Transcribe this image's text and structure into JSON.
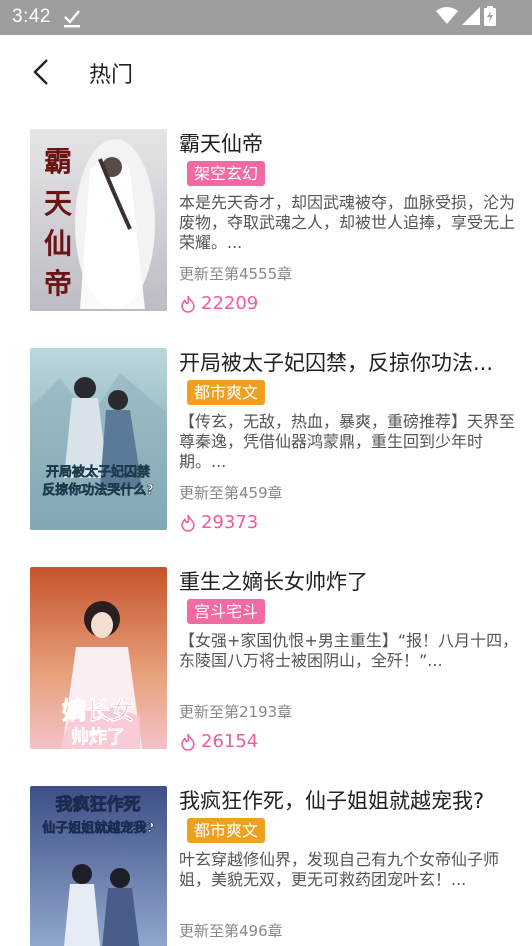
{
  "status_bar": {
    "time": "3:42"
  },
  "header": {
    "title": "热门"
  },
  "books": [
    {
      "title": "霸天仙帝",
      "tag": "架空玄幻",
      "tag_color": "#f06aa4",
      "desc": "本是先天奇才，却因武魂被夺，血脉受损，沦为废物，夺取武魂之人，却被世人追捧，享受无上荣耀。...",
      "update": "更新至第4555章",
      "hot": "22209",
      "cover_text": "霸天仙帝"
    },
    {
      "title": "开局被太子妃囚禁，反掠你功法...",
      "tag": "都市爽文",
      "tag_color": "#f0a020",
      "desc": "【传玄，无敌，热血，暴爽，重磅推荐】天界至尊秦逸，凭借仙器鸿蒙鼎，重生回到少年时期。...",
      "update": "更新至第459章",
      "hot": "29373",
      "cover_text": "开局被太子妃囚禁 反掠你功法哭什么?"
    },
    {
      "title": "重生之嫡长女帅炸了",
      "tag": "宫斗宅斗",
      "tag_color": "#f06aa4",
      "desc": "【女强+家国仇恨+男主重生】“报！八月十四，东陵国八万将士被困阴山，全歼！”...",
      "update": "更新至第2193章",
      "hot": "26154",
      "cover_text": "嫡长女帅炸了"
    },
    {
      "title": "我疯狂作死，仙子姐姐就越宠我?",
      "tag": "都市爽文",
      "tag_color": "#f0a020",
      "desc": "叶玄穿越修仙界，发现自己有九个女帝仙子师姐，美貌无双，更无可救药团宠叶玄！...",
      "update": "更新至第496章",
      "hot": "",
      "cover_text": "我疯狂作死 仙子姐姐就越宠我?"
    }
  ]
}
